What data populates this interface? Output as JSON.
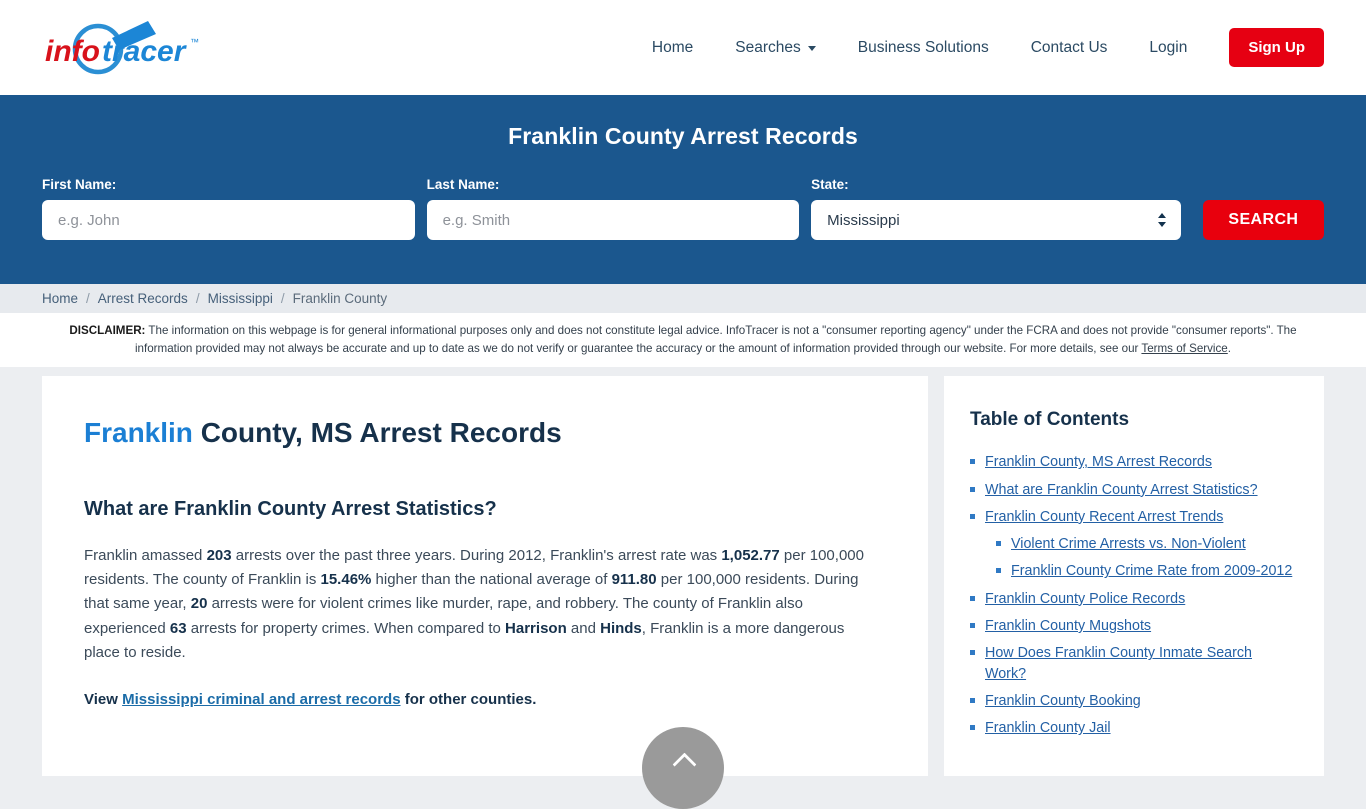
{
  "header": {
    "logo": {
      "part1": "info",
      "part2": "tracer",
      "tm": "™"
    },
    "nav": [
      {
        "label": "Home",
        "has_caret": false
      },
      {
        "label": "Searches",
        "has_caret": true
      },
      {
        "label": "Business Solutions",
        "has_caret": false
      },
      {
        "label": "Contact Us",
        "has_caret": false
      },
      {
        "label": "Login",
        "has_caret": false
      }
    ],
    "signup_label": "Sign Up"
  },
  "search_band": {
    "title": "Franklin County Arrest Records",
    "first_name_label": "First Name:",
    "first_name_placeholder": "e.g. John",
    "first_name_value": "",
    "last_name_label": "Last Name:",
    "last_name_placeholder": "e.g. Smith",
    "last_name_value": "",
    "state_label": "State:",
    "state_value": "Mississippi",
    "search_button": "SEARCH",
    "accent_blue": "#1b578e",
    "accent_red": "#e8000d"
  },
  "breadcrumb": {
    "items": [
      "Home",
      "Arrest Records",
      "Mississippi",
      "Franklin County"
    ],
    "separator": "/"
  },
  "disclaimer": {
    "label": "DISCLAIMER:",
    "text": " The information on this webpage is for general informational purposes only and does not constitute legal advice. InfoTracer is not a \"consumer reporting agency\" under the FCRA and does not provide \"consumer reports\". The information provided may not always be accurate and up to date as we do not verify or guarantee the accuracy or the amount of information provided through our website. For more details, see our ",
    "link_text": "Terms of Service",
    "period": "."
  },
  "main": {
    "title_highlight": "Franklin",
    "title_rest": " County, MS Arrest Records",
    "subheading": "What are Franklin County Arrest Statistics?",
    "paragraph_parts": [
      {
        "t": "Franklin amassed ",
        "b": false
      },
      {
        "t": "203",
        "b": true
      },
      {
        "t": " arrests over the past three years. During 2012, Franklin's arrest rate was ",
        "b": false
      },
      {
        "t": "1,052.77",
        "b": true
      },
      {
        "t": " per 100,000 residents. The county of Franklin is ",
        "b": false
      },
      {
        "t": "15.46%",
        "b": true
      },
      {
        "t": " higher than the national average of ",
        "b": false
      },
      {
        "t": "911.80",
        "b": true
      },
      {
        "t": " per 100,000 residents. During that same year, ",
        "b": false
      },
      {
        "t": "20",
        "b": true
      },
      {
        "t": " arrests were for violent crimes like murder, rape, and robbery. The county of Franklin also experienced ",
        "b": false
      },
      {
        "t": "63",
        "b": true
      },
      {
        "t": " arrests for property crimes. When compared to ",
        "b": false
      },
      {
        "t": "Harrison",
        "b": true
      },
      {
        "t": " and ",
        "b": false
      },
      {
        "t": "Hinds",
        "b": true
      },
      {
        "t": ", Franklin is a more dangerous place to reside.",
        "b": false
      }
    ],
    "view_prefix": "View ",
    "view_link": "Mississippi criminal and arrest records",
    "view_suffix": " for other counties."
  },
  "toc": {
    "title": "Table of Contents",
    "items": [
      {
        "label": "Franklin County, MS Arrest Records",
        "sub": false
      },
      {
        "label": "What are Franklin County Arrest Statistics?",
        "sub": false
      },
      {
        "label": "Franklin County Recent Arrest Trends",
        "sub": false
      },
      {
        "label": "Violent Crime Arrests vs. Non-Violent",
        "sub": true
      },
      {
        "label": "Franklin County Crime Rate from 2009-2012",
        "sub": true
      },
      {
        "label": "Franklin County Police Records",
        "sub": false
      },
      {
        "label": "Franklin County Mugshots",
        "sub": false
      },
      {
        "label": "How Does Franklin County Inmate Search Work?",
        "sub": false
      },
      {
        "label": "Franklin County Booking",
        "sub": false
      },
      {
        "label": "Franklin County Jail",
        "sub": false
      }
    ]
  },
  "scroll_top": {
    "icon": "chevron-up-icon"
  }
}
